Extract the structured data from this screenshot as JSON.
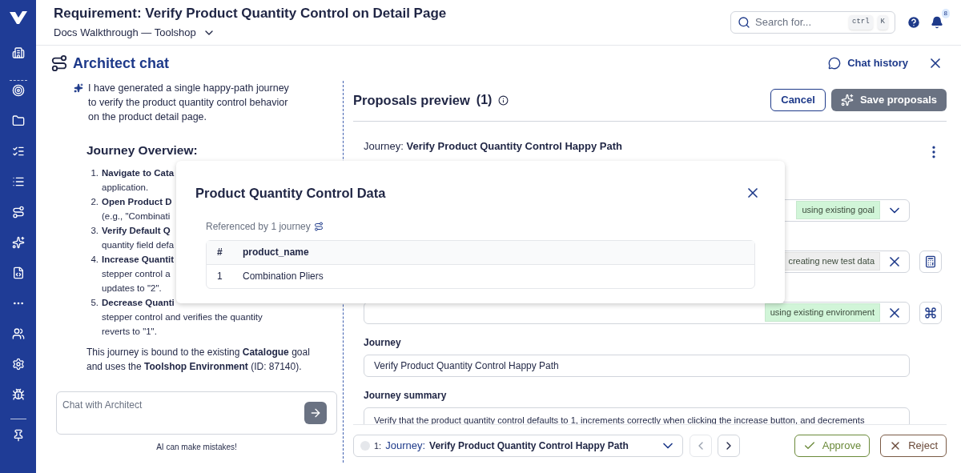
{
  "header": {
    "title": "Requirement: Verify Product Quantity Control on Detail Page",
    "project": "Docs Walkthrough — Toolshop",
    "search": {
      "placeholder": "Search for...",
      "keys": [
        "ctrl",
        "K"
      ]
    },
    "notification_count": "8"
  },
  "chat": {
    "title": "Architect chat",
    "history_link": "Chat history",
    "intro": "I have generated a single happy-path journey to verify the product quantity control behavior on the product detail page.",
    "overview_heading": "Journey Overview:",
    "steps": [
      {
        "number": "1.",
        "title": "Navigate to Cata",
        "lines": [
          "application."
        ]
      },
      {
        "number": "2.",
        "title": "Open Product D",
        "lines": [
          "(e.g., \"Combinati"
        ]
      },
      {
        "number": "3.",
        "title": "Verify Default Q",
        "lines": [
          "quantity field defa"
        ]
      },
      {
        "number": "4.",
        "title": "Increase Quantit",
        "lines": [
          "stepper control a",
          "updates to \"2\"."
        ]
      },
      {
        "number": "5.",
        "title": "Decrease Quanti",
        "lines": [
          "stepper control and verifies the quantity",
          "reverts to \"1\"."
        ]
      }
    ],
    "closing": "This journey is bound to the existing **Catalogue** goal and uses the **Toolshop Environment** (ID: 87140).",
    "input": {
      "placeholder": "Chat with Architect"
    },
    "disclaimer": "AI can make mistakes!"
  },
  "proposals": {
    "title": "Proposals preview",
    "count": "(1)",
    "cancel": "Cancel",
    "save": {
      "label": "Save proposals",
      "disabled": true
    },
    "journey": {
      "label": "Journey:",
      "name": "Verify Product Quantity Control Happy Path"
    },
    "fields": [
      {
        "kind": "select",
        "badge": "using existing goal",
        "color": "#d1f5d8"
      },
      {
        "kind": "clearable",
        "badge": "creating new test data",
        "color": "#eeeeee"
      },
      {
        "kind": "clearable",
        "badge": "using existing environment",
        "color": "#d1f5d8"
      }
    ],
    "journey_field": {
      "label": "Journey",
      "value": "Verify Product Quantity Control Happy Path"
    },
    "summary_field": {
      "label": "Journey summary",
      "value": "Verify that the product quantity control defaults to 1, increments correctly when clicking the increase button, and decrements"
    }
  },
  "footer": {
    "index": "1:",
    "label": "Journey:",
    "name": "Verify Product Quantity Control Happy Path",
    "prev_disabled": true,
    "approve": "Approve",
    "reject": "Reject"
  },
  "modal": {
    "title": "Product Quantity Control Data",
    "referenced": "Referenced by 1 journey",
    "columns": [
      "#",
      "product_name"
    ],
    "rows": [
      [
        "1",
        "Combination Pliers"
      ]
    ]
  }
}
